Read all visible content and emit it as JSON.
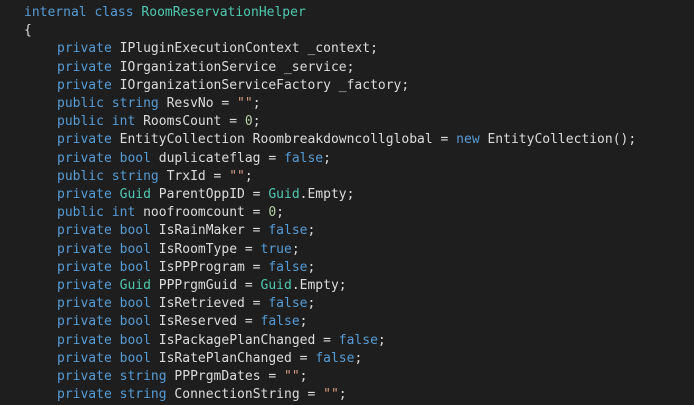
{
  "editor": {
    "language": "csharp",
    "colors": {
      "background": "#1e1e1e",
      "keyword": "#569cd6",
      "type": "#4ec9b0",
      "identifier": "#dcdcdc",
      "string": "#d69d85",
      "number": "#b5cea8"
    },
    "lines": [
      [
        [
          "kw",
          "internal"
        ],
        [
          "pu",
          " "
        ],
        [
          "kw",
          "class"
        ],
        [
          "pu",
          " "
        ],
        [
          "ty",
          "RoomReservationHelper"
        ]
      ],
      [
        [
          "pu",
          "{"
        ]
      ],
      [
        [
          "kw",
          "private"
        ],
        [
          "pu",
          " "
        ],
        [
          "id",
          "IPluginExecutionContext _context;"
        ]
      ],
      [
        [
          "kw",
          "private"
        ],
        [
          "pu",
          " "
        ],
        [
          "id",
          "IOrganizationService _service;"
        ]
      ],
      [
        [
          "kw",
          "private"
        ],
        [
          "pu",
          " "
        ],
        [
          "id",
          "IOrganizationServiceFactory _factory;"
        ]
      ],
      [
        [
          "kw",
          "public"
        ],
        [
          "pu",
          " "
        ],
        [
          "kw",
          "string"
        ],
        [
          "pu",
          " "
        ],
        [
          "id",
          "ResvNo = "
        ],
        [
          "st",
          "\"\""
        ],
        [
          "pu",
          ";"
        ]
      ],
      [
        [
          "kw",
          "public"
        ],
        [
          "pu",
          " "
        ],
        [
          "kw",
          "int"
        ],
        [
          "pu",
          " "
        ],
        [
          "id",
          "RoomsCount = "
        ],
        [
          "nu",
          "0"
        ],
        [
          "pu",
          ";"
        ]
      ],
      [
        [
          "kw",
          "private"
        ],
        [
          "pu",
          " "
        ],
        [
          "id",
          "EntityCollection Roombreakdowncollglobal = "
        ],
        [
          "kw",
          "new"
        ],
        [
          "pu",
          " "
        ],
        [
          "id",
          "EntityCollection();"
        ]
      ],
      [
        [
          "kw",
          "private"
        ],
        [
          "pu",
          " "
        ],
        [
          "kw",
          "bool"
        ],
        [
          "pu",
          " "
        ],
        [
          "id",
          "duplicateflag = "
        ],
        [
          "kw",
          "false"
        ],
        [
          "pu",
          ";"
        ]
      ],
      [
        [
          "kw",
          "public"
        ],
        [
          "pu",
          " "
        ],
        [
          "kw",
          "string"
        ],
        [
          "pu",
          " "
        ],
        [
          "id",
          "TrxId = "
        ],
        [
          "st",
          "\"\""
        ],
        [
          "pu",
          ";"
        ]
      ],
      [
        [
          "kw",
          "private"
        ],
        [
          "pu",
          " "
        ],
        [
          "ty",
          "Guid"
        ],
        [
          "pu",
          " "
        ],
        [
          "id",
          "ParentOppID = "
        ],
        [
          "ty",
          "Guid"
        ],
        [
          "id",
          ".Empty;"
        ]
      ],
      [
        [
          "kw",
          "public"
        ],
        [
          "pu",
          " "
        ],
        [
          "kw",
          "int"
        ],
        [
          "pu",
          " "
        ],
        [
          "id",
          "noofroomcount = "
        ],
        [
          "nu",
          "0"
        ],
        [
          "pu",
          ";"
        ]
      ],
      [
        [
          "kw",
          "private"
        ],
        [
          "pu",
          " "
        ],
        [
          "kw",
          "bool"
        ],
        [
          "pu",
          " "
        ],
        [
          "id",
          "IsRainMaker = "
        ],
        [
          "kw",
          "false"
        ],
        [
          "pu",
          ";"
        ]
      ],
      [
        [
          "kw",
          "private"
        ],
        [
          "pu",
          " "
        ],
        [
          "kw",
          "bool"
        ],
        [
          "pu",
          " "
        ],
        [
          "id",
          "IsRoomType = "
        ],
        [
          "kw",
          "true"
        ],
        [
          "pu",
          ";"
        ]
      ],
      [
        [
          "kw",
          "private"
        ],
        [
          "pu",
          " "
        ],
        [
          "kw",
          "bool"
        ],
        [
          "pu",
          " "
        ],
        [
          "id",
          "IsPPProgram = "
        ],
        [
          "kw",
          "false"
        ],
        [
          "pu",
          ";"
        ]
      ],
      [
        [
          "kw",
          "private"
        ],
        [
          "pu",
          " "
        ],
        [
          "ty",
          "Guid"
        ],
        [
          "pu",
          " "
        ],
        [
          "id",
          "PPPrgmGuid = "
        ],
        [
          "ty",
          "Guid"
        ],
        [
          "id",
          ".Empty;"
        ]
      ],
      [
        [
          "kw",
          "private"
        ],
        [
          "pu",
          " "
        ],
        [
          "kw",
          "bool"
        ],
        [
          "pu",
          " "
        ],
        [
          "id",
          "IsRetrieved = "
        ],
        [
          "kw",
          "false"
        ],
        [
          "pu",
          ";"
        ]
      ],
      [
        [
          "kw",
          "private"
        ],
        [
          "pu",
          " "
        ],
        [
          "kw",
          "bool"
        ],
        [
          "pu",
          " "
        ],
        [
          "id",
          "IsReserved = "
        ],
        [
          "kw",
          "false"
        ],
        [
          "pu",
          ";"
        ]
      ],
      [
        [
          "kw",
          "private"
        ],
        [
          "pu",
          " "
        ],
        [
          "kw",
          "bool"
        ],
        [
          "pu",
          " "
        ],
        [
          "id",
          "IsPackagePlanChanged = "
        ],
        [
          "kw",
          "false"
        ],
        [
          "pu",
          ";"
        ]
      ],
      [
        [
          "kw",
          "private"
        ],
        [
          "pu",
          " "
        ],
        [
          "kw",
          "bool"
        ],
        [
          "pu",
          " "
        ],
        [
          "id",
          "IsRatePlanChanged = "
        ],
        [
          "kw",
          "false"
        ],
        [
          "pu",
          ";"
        ]
      ],
      [
        [
          "kw",
          "private"
        ],
        [
          "pu",
          " "
        ],
        [
          "kw",
          "string"
        ],
        [
          "pu",
          " "
        ],
        [
          "id",
          "PPPrgmDates = "
        ],
        [
          "st",
          "\"\""
        ],
        [
          "pu",
          ";"
        ]
      ],
      [
        [
          "kw",
          "private"
        ],
        [
          "pu",
          " "
        ],
        [
          "kw",
          "string"
        ],
        [
          "pu",
          " "
        ],
        [
          "id",
          "ConnectionString = "
        ],
        [
          "st",
          "\"\""
        ],
        [
          "pu",
          ";"
        ]
      ]
    ]
  }
}
